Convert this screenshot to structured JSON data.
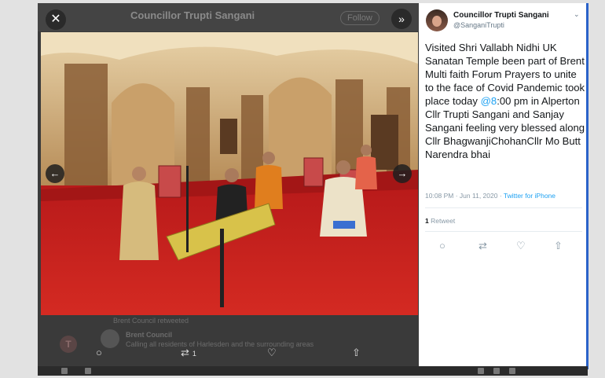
{
  "backdrop": {
    "header_title": "Councillor Trupti Sangani",
    "follow_label": "Follow",
    "bottom_lines": [
      "Brent Council retweeted",
      "Brent Council",
      "Calling all residents of Harlesden and the surrounding areas"
    ]
  },
  "modal": {
    "close_icon": "close-icon",
    "expand_icon": "expand-icon",
    "prev_icon": "chevron-left-icon",
    "next_icon": "chevron-right-icon",
    "actions": {
      "reply_icon": "reply-icon",
      "retweet_icon": "retweet-icon",
      "retweet_count": "1",
      "like_icon": "heart-icon",
      "share_icon": "share-icon"
    }
  },
  "tweet": {
    "author_name": "Councillor Trupti Sangani",
    "author_handle": "@SanganiTrupti",
    "text_before_mention": "Visited Shri Vallabh Nidhi UK Sanatan Temple been part of Brent Multi faith Forum Prayers to unite to the face of Covid Pandemic took place today ",
    "mention": "@8",
    "text_after_mention": ":00 pm in Alperton Cllr Trupti Sangani and Sanjay Sangani feeling very blessed along Cllr BhagwanjiChohanCllr Mo Butt Narendra bhai",
    "timestamp": "10:08 PM · Jun 11, 2020 · ",
    "source": "Twitter for iPhone",
    "retweet_count": "1",
    "retweet_label": " Retweet"
  },
  "colors": {
    "accent": "#1da1f2",
    "text": "#14171a",
    "muted": "#8899a6",
    "carpet": "#c8201e"
  }
}
